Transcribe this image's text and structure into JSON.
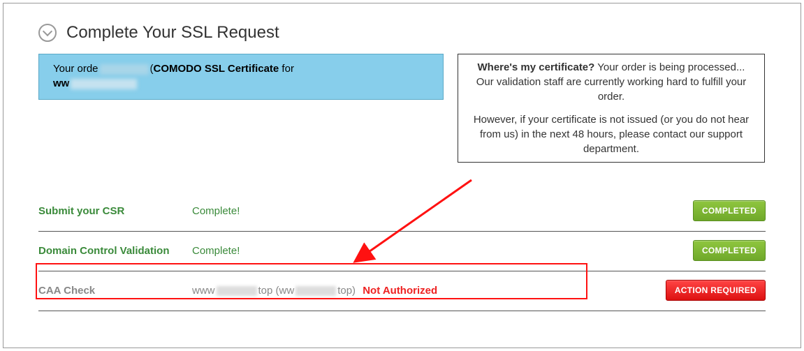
{
  "header": {
    "title": "Complete Your SSL Request"
  },
  "order_box": {
    "prefix": "Your orde",
    "middle": "(",
    "cert_name": "COMODO SSL Certificate",
    "for_text": " for",
    "domain_prefix": "ww"
  },
  "info_box": {
    "heading": "Where's my certificate?",
    "line1": " Your order is being processed... Our validation staff are currently working hard to fulfill your order.",
    "line2": "However, if your certificate is not issued (or you do not hear from us) in the next 48 hours, please contact our support department."
  },
  "steps": [
    {
      "label": "Submit your CSR",
      "status": "Complete!",
      "badge": "COMPLETED",
      "state": "green"
    },
    {
      "label": "Domain Control Validation",
      "status": "Complete!",
      "badge": "COMPLETED",
      "state": "green"
    },
    {
      "label": "CAA Check",
      "status_prefix": "www",
      "status_mid": "top  (ww",
      "status_suffix": "top)",
      "not_authorized": "Not Authorized",
      "badge": "ACTION REQUIRED",
      "state": "gray"
    }
  ]
}
